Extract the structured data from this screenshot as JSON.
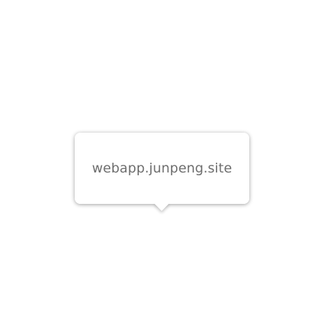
{
  "tooltip": {
    "text": "webapp.junpeng.site"
  }
}
